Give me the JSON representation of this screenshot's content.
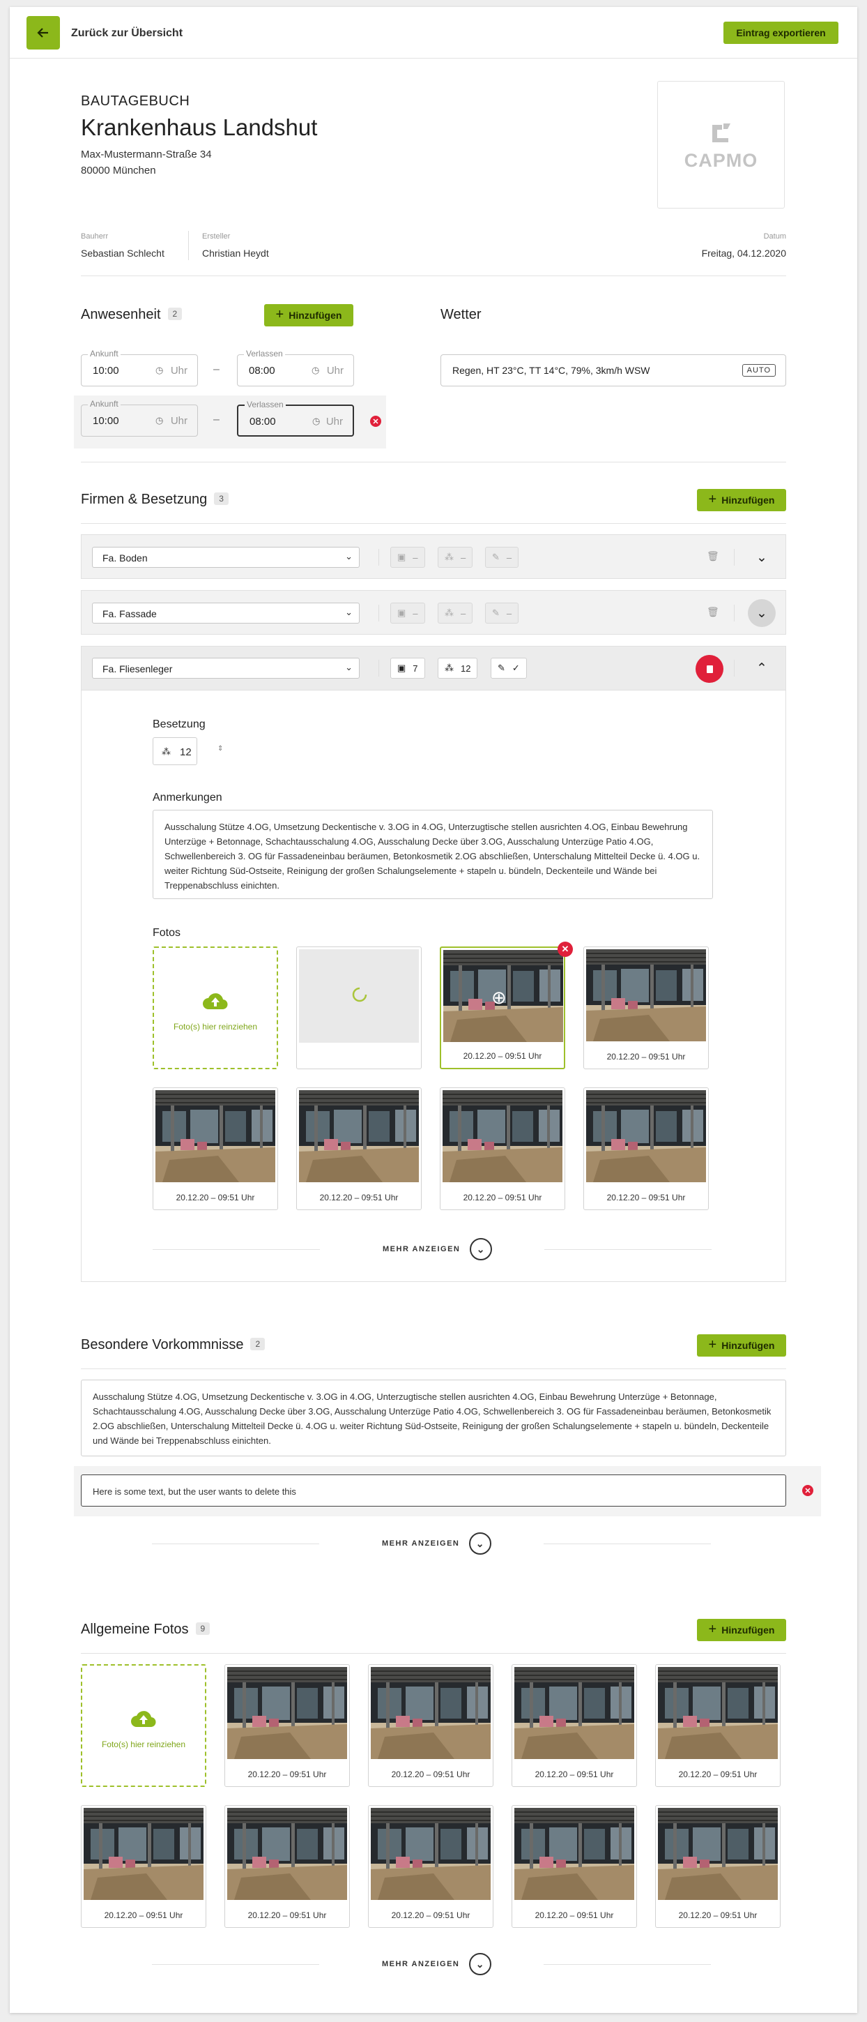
{
  "topbar": {
    "back_label": "Zurück zur Übersicht",
    "export_label": "Eintrag exportieren"
  },
  "header": {
    "kicker": "BAUTAGEBUCH",
    "title": "Krankenhaus Landshut",
    "address_line1": "Max-Mustermann-Straße 34",
    "address_line2": "80000 München",
    "logo_text": "CAPMO"
  },
  "meta": {
    "bauherr_label": "Bauherr",
    "bauherr": "Sebastian Schlecht",
    "ersteller_label": "Ersteller",
    "ersteller": "Christian Heydt",
    "datum_label": "Datum",
    "datum": "Freitag, 04.12.2020"
  },
  "anwesenheit": {
    "title": "Anwesenheit",
    "count": "2",
    "add_label": "Hinzufügen",
    "rows": [
      {
        "ankunft_label": "Ankunft",
        "ankunft": "10:00",
        "verlassen_label": "Verlassen",
        "verlassen": "08:00",
        "unit": "Uhr"
      },
      {
        "ankunft_label": "Ankunft",
        "ankunft": "10:00",
        "verlassen_label": "Verlassen",
        "verlassen": "08:00",
        "unit": "Uhr"
      }
    ],
    "separator": "–"
  },
  "wetter": {
    "title": "Wetter",
    "value": "Regen, HT 23°C, TT 14°C, 79%, 3km/h WSW",
    "badge": "AUTO"
  },
  "firmen": {
    "title": "Firmen & Besetzung",
    "count": "3",
    "add_label": "Hinzufügen",
    "companies": [
      {
        "name": "Fa. Boden",
        "photos": "–",
        "people": "–",
        "edit": "–"
      },
      {
        "name": "Fa. Fassade",
        "photos": "–",
        "people": "–",
        "edit": "–"
      },
      {
        "name": "Fa. Fliesenleger",
        "photos": "7",
        "people": "12",
        "edit": "✓"
      }
    ],
    "besetzung_label": "Besetzung",
    "besetzung_value": "12",
    "anmerkungen_label": "Anmerkungen",
    "anmerkungen_text": "Ausschalung Stütze 4.OG, Umsetzung Deckentische v. 3.OG in 4.OG, Unterzugtische stellen ausrichten 4.OG, Einbau Bewehrung Unterzüge + Betonnage, Schachtausschalung 4.OG, Ausschalung Decke über 3.OG, Ausschalung Unterzüge Patio 4.OG, Schwellenbereich 3. OG für Fassadeneinbau beräumen, Betonkosmetik 2.OG abschließen, Unterschalung Mittelteil Decke ü. 4.OG u. weiter Richtung Süd-Ostseite, Reinigung der großen Schalungselemente + stapeln u. bündeln, Deckenteile und Wände bei Treppenabschluss einichten.",
    "fotos_label": "Fotos",
    "upload_label": "Foto(s) hier reinziehen",
    "photo_caption": "20.12.20 – 09:51 Uhr",
    "more_label": "MEHR ANZEIGEN"
  },
  "vorkommnisse": {
    "title": "Besondere Vorkommnisse",
    "count": "2",
    "add_label": "Hinzufügen",
    "text1": "Ausschalung Stütze 4.OG, Umsetzung Deckentische v. 3.OG in 4.OG, Unterzugtische stellen ausrichten 4.OG, Einbau Bewehrung Unterzüge + Betonnage, Schachtausschalung 4.OG, Ausschalung Decke über 3.OG, Ausschalung Unterzüge Patio 4.OG, Schwellenbereich 3. OG für Fassadeneinbau beräumen, Betonkosmetik 2.OG abschließen, Unterschalung Mittelteil Decke ü. 4.OG u. weiter Richtung Süd-Ostseite, Reinigung der großen Schalungselemente + stapeln u. bündeln, Deckenteile und Wände bei Treppenabschluss einichten.",
    "text2": "Here is some text, but the user wants to delete this",
    "more_label": "MEHR ANZEIGEN"
  },
  "allgemeine_fotos": {
    "title": "Allgemeine Fotos",
    "count": "9",
    "add_label": "Hinzufügen",
    "upload_label": "Foto(s) hier reinziehen",
    "photo_caption": "20.12.20 – 09:51 Uhr",
    "more_label": "MEHR ANZEIGEN"
  },
  "colors": {
    "accent": "#8cb81b",
    "danger": "#e0203a"
  }
}
